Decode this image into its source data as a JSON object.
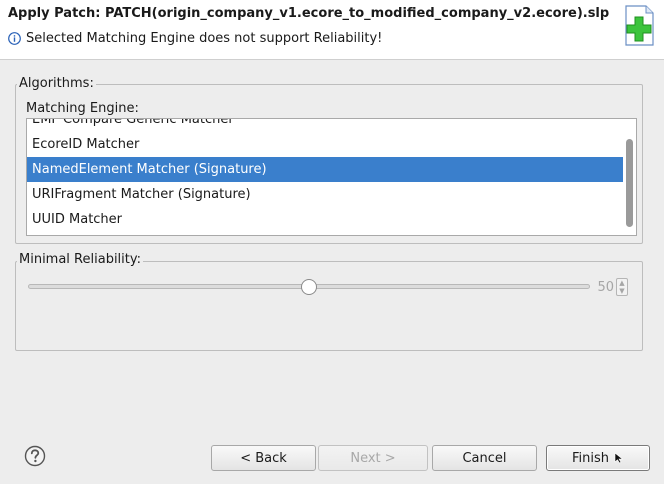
{
  "header": {
    "title": "Apply Patch: PATCH(origin_company_v1.ecore_to_modified_company_v2.ecore).slp",
    "message": "Selected Matching Engine does not support Reliability!"
  },
  "algorithms": {
    "group_label": "Algorithms:",
    "engine_label": "Matching Engine:",
    "items": [
      {
        "label": "EMF Compare Generic Matcher"
      },
      {
        "label": "EcoreID Matcher"
      },
      {
        "label": "NamedElement Matcher (Signature)"
      },
      {
        "label": "URIFragment Matcher (Signature)"
      },
      {
        "label": "UUID Matcher"
      }
    ],
    "selected_index": 2
  },
  "reliability": {
    "group_label": "Minimal Reliability:",
    "value": "50",
    "slider_fraction": 0.5
  },
  "buttons": {
    "back": "< Back",
    "next": "Next >",
    "cancel": "Cancel",
    "finish": "Finish"
  },
  "colors": {
    "selection": "#3a7fcc",
    "background": "#ededed",
    "banner_plus": "#3cc43c",
    "info": "#2a62b8"
  }
}
